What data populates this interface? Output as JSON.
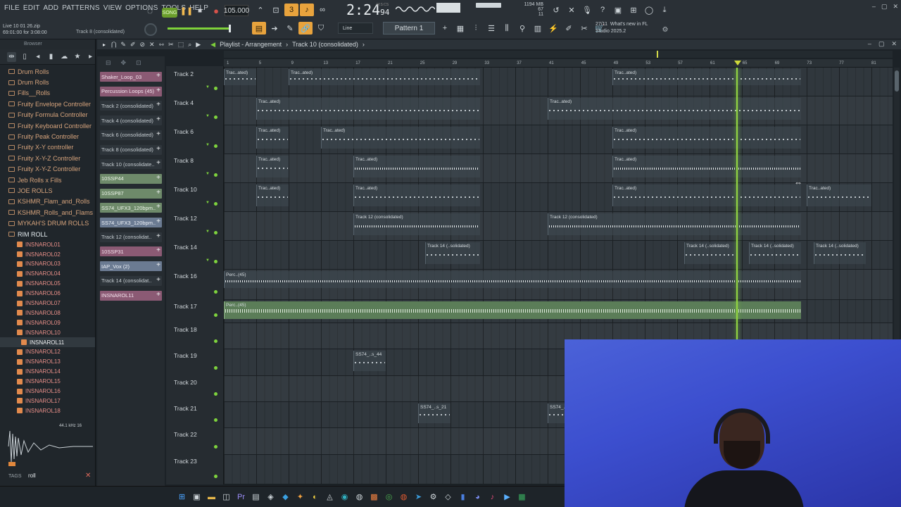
{
  "menu": [
    "FILE",
    "EDIT",
    "ADD",
    "PATTERNS",
    "VIEW",
    "OPTIONS",
    "TOOLS",
    "HELP"
  ],
  "transport": {
    "song_label": "SONG",
    "tempo": "105.000",
    "time": "2:24",
    "time_small": "94",
    "mcs_label": "M:S:CS"
  },
  "perf": {
    "memory": "1194 MB",
    "cpu": "67",
    "voices": "11"
  },
  "project": {
    "file": "Live 10 01 26.zip",
    "time": "69:01:00 for 3:08:00",
    "hint": "Track 8 (consolidated)"
  },
  "snap": "Line",
  "pattern_selector": "Pattern 1",
  "news": {
    "date": "27/11",
    "title": "What's new in FL",
    "subtitle": "Studio 2025.2"
  },
  "browser": {
    "title": "Browser",
    "folders": [
      "Drum Rolls",
      "Drum Rolls",
      "Fills__Rolls",
      "Fruity Envelope Controller",
      "Fruity Formula Controller",
      "Fruity Keyboard Controller",
      "Fruity Peak Controller",
      "Fruity X-Y controller",
      "Fruity X-Y-Z Controller",
      "Fruity X-Y-Z Controller",
      "Jeb Rolls x Fills",
      "JOE ROLLS",
      "KSHMR_Flam_and_Rolls",
      "KSHMR_Rolls_and_Flams",
      "MYKAH'S DRUM ROLLS"
    ],
    "open_folder": "RIM ROLL",
    "files": [
      "INSNAROL01",
      "INSNAROL02",
      "INSNAROL03",
      "INSNAROL04",
      "INSNAROL05",
      "INSNAROL06",
      "INSNAROL07",
      "INSNAROL08",
      "INSNAROL09",
      "INSNAROL10",
      "INSNAROL11",
      "INSNAROL12",
      "INSNAROL13",
      "INSNAROL14",
      "INSNAROL15",
      "INSNAROL16",
      "INSNAROL17",
      "INSNAROL18"
    ],
    "selected_file": "INSNAROL11",
    "sample_rate": "44.1 kHz 16",
    "tags_label": "TAGS",
    "tags_value": "roll"
  },
  "playlist": {
    "title": "Playlist - Arrangement",
    "context": "Track 10 (consolidated)",
    "patterns": [
      {
        "name": "Shaker_Loop_03",
        "color": "pink"
      },
      {
        "name": "Percussion Loops (45)",
        "color": "pink"
      },
      {
        "name": "Track 2 (consolidated)",
        "color": "dark"
      },
      {
        "name": "Track 4 (consolidated)",
        "color": "dark"
      },
      {
        "name": "Track 6 (consolidated)",
        "color": "dark"
      },
      {
        "name": "Track 8 (consolidated)",
        "color": "dark"
      },
      {
        "name": "Track 10 (consolidate..",
        "color": "dark"
      },
      {
        "name": "10SSP44",
        "color": "green"
      },
      {
        "name": "10SSP87",
        "color": "green"
      },
      {
        "name": "SS74_UFX3_120bpm..",
        "color": "green"
      },
      {
        "name": "SS74_UFX3_120bpm..",
        "color": "blue"
      },
      {
        "name": "Track 12 (consolidat..",
        "color": "dark"
      },
      {
        "name": "10SSP31",
        "color": "pink"
      },
      {
        "name": "IAP_Vox (2)",
        "color": "blue"
      },
      {
        "name": "Track 14 (consolidat..",
        "color": "dark"
      },
      {
        "name": "INSNAROL11",
        "color": "pink"
      }
    ],
    "tracks": [
      "Track 2",
      "Track 4",
      "Track 6",
      "Track 8",
      "Track 10",
      "Track 12",
      "Track 14",
      "Track 16",
      "Track 17",
      "Track 18",
      "Track 19",
      "Track 20",
      "Track 21",
      "Track 22",
      "Track 23"
    ],
    "ruler": [
      "1",
      "5",
      "9",
      "13",
      "17",
      "21",
      "25",
      "29",
      "33",
      "37",
      "41",
      "45",
      "49",
      "53",
      "57",
      "61",
      "65",
      "69",
      "73",
      "77",
      "81"
    ],
    "clip_labels": {
      "short": "Trac..ated)",
      "track12": "Track 12 (consolidated)",
      "track14": "Track 14 (..solidated)",
      "perc": "Perc..(45)",
      "ss74a": "SS74_..s_44",
      "ss74b": "SS74_..s_21"
    }
  }
}
